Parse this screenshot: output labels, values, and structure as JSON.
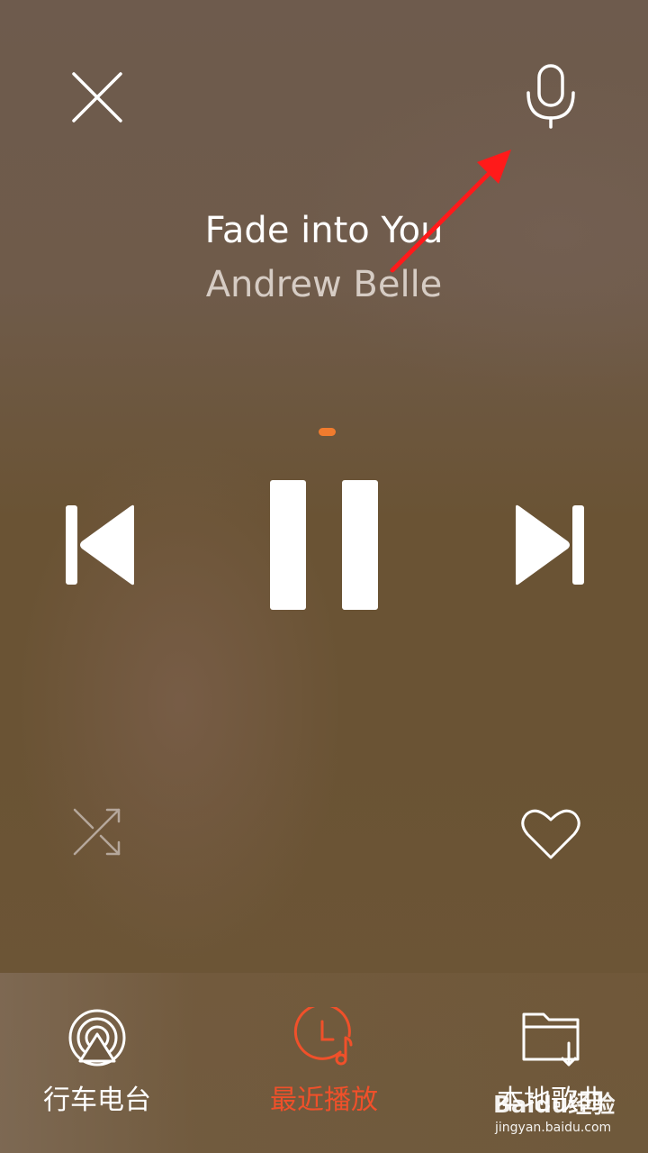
{
  "player": {
    "title": "Fade into You",
    "artist": "Andrew Belle",
    "progress_fraction": 0.0,
    "playing": true,
    "favorited": false
  },
  "controls": {
    "close_icon": "close-icon",
    "mic_icon": "microphone-icon",
    "prev_icon": "skip-previous-icon",
    "pause_icon": "pause-icon",
    "next_icon": "skip-next-icon",
    "shuffle_icon": "shuffle-icon",
    "favorite_icon": "heart-icon"
  },
  "bottom_nav": {
    "items": [
      {
        "label": "行车电台",
        "icon": "car-radio-icon",
        "active": false
      },
      {
        "label": "最近播放",
        "icon": "recent-clock-music-icon",
        "active": true
      },
      {
        "label": "本地歌曲",
        "icon": "local-folder-download-icon",
        "active": false
      }
    ]
  },
  "watermark": {
    "text": "Baidu经验",
    "url_text": "jingyan.baidu.com"
  },
  "colors": {
    "accent": "#f0502a",
    "progress": "#f07b2e",
    "annotation_arrow": "#ff1a1a",
    "text_primary": "#ffffff",
    "text_secondary": "#d6ccc4"
  }
}
